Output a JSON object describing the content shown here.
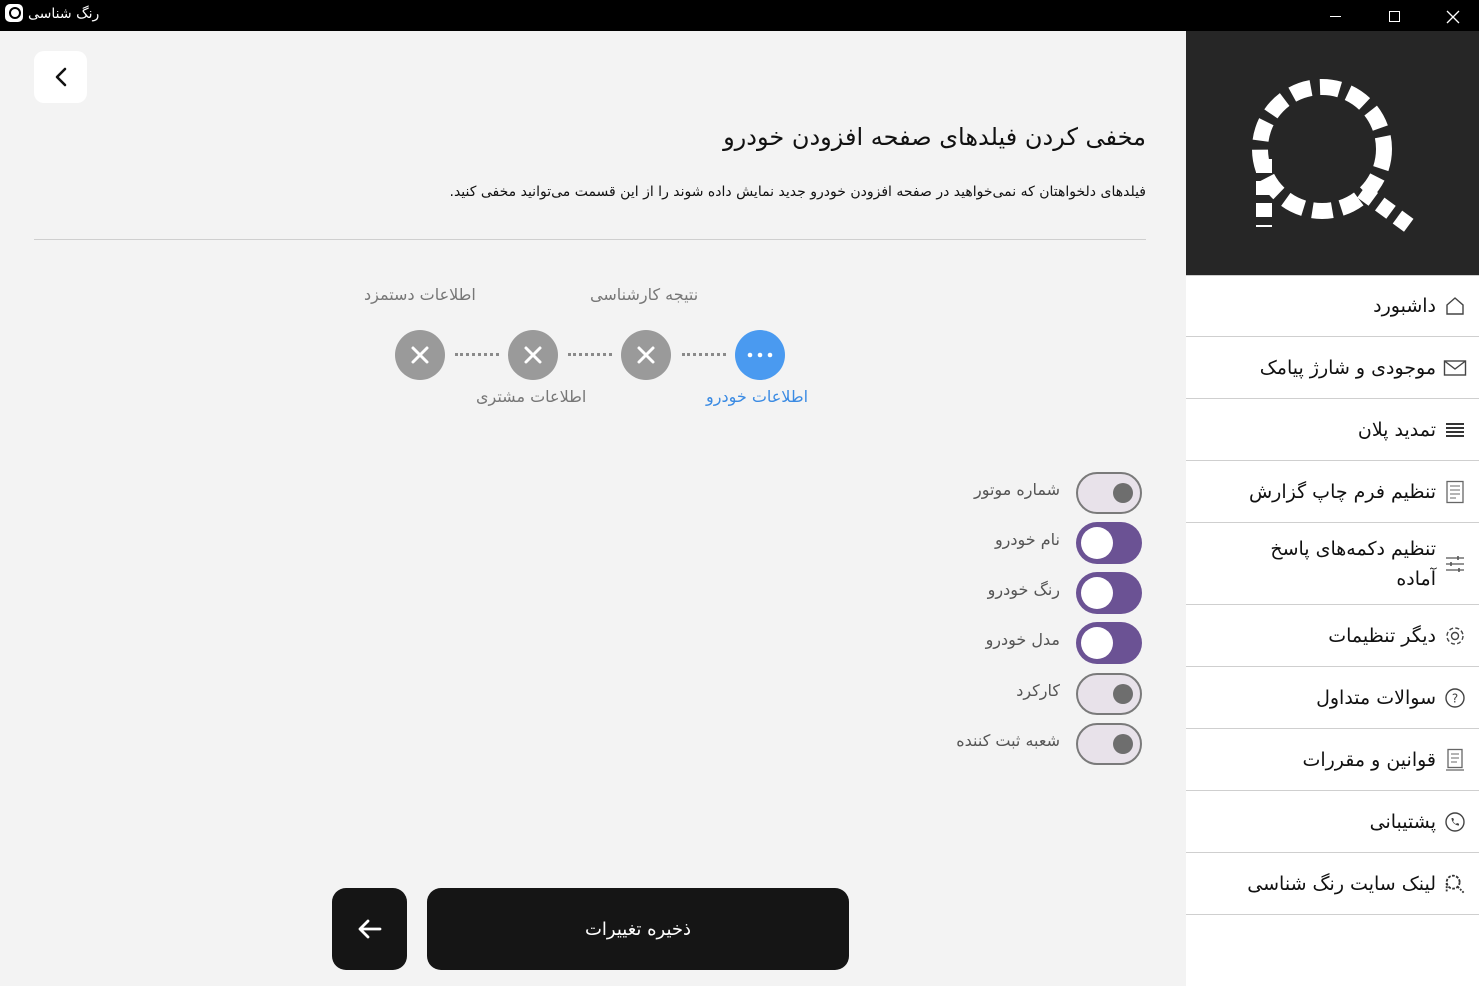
{
  "window": {
    "title": "رنگ شناسی"
  },
  "sidebar": {
    "items": [
      {
        "label": "داشبورد",
        "icon": "home-icon"
      },
      {
        "label": "موجودی و شارژ پیامک",
        "icon": "mail-icon"
      },
      {
        "label": "تمدید پلان",
        "icon": "list-icon"
      },
      {
        "label": "تنظیم فرم چاپ گزارش",
        "icon": "report-icon"
      },
      {
        "label": "تنظیم دکمه‌های پاسخ آماده",
        "icon": "sliders-icon"
      },
      {
        "label": "دیگر تنظیمات",
        "icon": "gear-icon"
      },
      {
        "label": "سوالات متداول",
        "icon": "question-icon"
      },
      {
        "label": "قوانین و مقررات",
        "icon": "document-icon"
      },
      {
        "label": "پشتیبانی",
        "icon": "whatsapp-icon"
      },
      {
        "label": "لینک سایت رنگ شناسی",
        "icon": "logo-link-icon"
      }
    ]
  },
  "main": {
    "title": "مخفی کردن فیلدهای صفحه افزودن خودرو",
    "description": "فیلدهای دلخواهتان که نمی‌خواهید در صفحه افزودن خودرو جدید نمایش داده شوند را از این قسمت می‌توانید مخفی کنید.",
    "steps": [
      {
        "label": "اطلاعات خودرو",
        "state": "active"
      },
      {
        "label": "نتیجه کارشناسی",
        "state": "inactive"
      },
      {
        "label": "اطلاعات مشتری",
        "state": "inactive"
      },
      {
        "label": "اطلاعات دستمزد",
        "state": "inactive"
      }
    ],
    "fields": [
      {
        "label": "شماره موتور",
        "enabled": false
      },
      {
        "label": "نام خودرو",
        "enabled": true
      },
      {
        "label": "رنگ خودرو",
        "enabled": true
      },
      {
        "label": "مدل خودرو",
        "enabled": true
      },
      {
        "label": "کارکرد",
        "enabled": false
      },
      {
        "label": "شعبه ثبت کننده",
        "enabled": false
      }
    ],
    "save_label": "ذخیره تغییرات"
  },
  "colors": {
    "accent_active_step": "#4a9af0",
    "toggle_on": "#6b5294",
    "button_dark": "#151515",
    "sidebar_logo_bg": "#262626"
  }
}
